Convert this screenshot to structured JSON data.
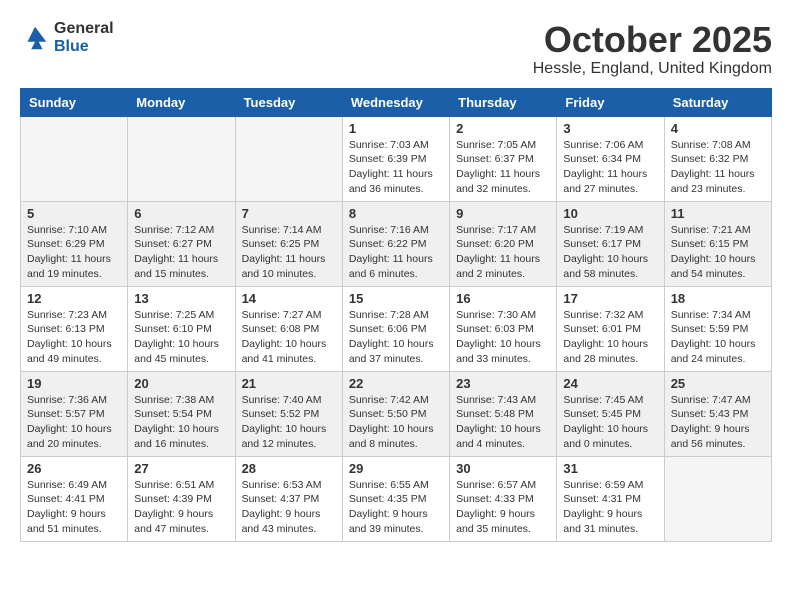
{
  "logo": {
    "general": "General",
    "blue": "Blue"
  },
  "title": {
    "month": "October 2025",
    "location": "Hessle, England, United Kingdom"
  },
  "headers": [
    "Sunday",
    "Monday",
    "Tuesday",
    "Wednesday",
    "Thursday",
    "Friday",
    "Saturday"
  ],
  "weeks": [
    {
      "shaded": false,
      "days": [
        {
          "number": "",
          "info": ""
        },
        {
          "number": "",
          "info": ""
        },
        {
          "number": "",
          "info": ""
        },
        {
          "number": "1",
          "info": "Sunrise: 7:03 AM\nSunset: 6:39 PM\nDaylight: 11 hours\nand 36 minutes."
        },
        {
          "number": "2",
          "info": "Sunrise: 7:05 AM\nSunset: 6:37 PM\nDaylight: 11 hours\nand 32 minutes."
        },
        {
          "number": "3",
          "info": "Sunrise: 7:06 AM\nSunset: 6:34 PM\nDaylight: 11 hours\nand 27 minutes."
        },
        {
          "number": "4",
          "info": "Sunrise: 7:08 AM\nSunset: 6:32 PM\nDaylight: 11 hours\nand 23 minutes."
        }
      ]
    },
    {
      "shaded": true,
      "days": [
        {
          "number": "5",
          "info": "Sunrise: 7:10 AM\nSunset: 6:29 PM\nDaylight: 11 hours\nand 19 minutes."
        },
        {
          "number": "6",
          "info": "Sunrise: 7:12 AM\nSunset: 6:27 PM\nDaylight: 11 hours\nand 15 minutes."
        },
        {
          "number": "7",
          "info": "Sunrise: 7:14 AM\nSunset: 6:25 PM\nDaylight: 11 hours\nand 10 minutes."
        },
        {
          "number": "8",
          "info": "Sunrise: 7:16 AM\nSunset: 6:22 PM\nDaylight: 11 hours\nand 6 minutes."
        },
        {
          "number": "9",
          "info": "Sunrise: 7:17 AM\nSunset: 6:20 PM\nDaylight: 11 hours\nand 2 minutes."
        },
        {
          "number": "10",
          "info": "Sunrise: 7:19 AM\nSunset: 6:17 PM\nDaylight: 10 hours\nand 58 minutes."
        },
        {
          "number": "11",
          "info": "Sunrise: 7:21 AM\nSunset: 6:15 PM\nDaylight: 10 hours\nand 54 minutes."
        }
      ]
    },
    {
      "shaded": false,
      "days": [
        {
          "number": "12",
          "info": "Sunrise: 7:23 AM\nSunset: 6:13 PM\nDaylight: 10 hours\nand 49 minutes."
        },
        {
          "number": "13",
          "info": "Sunrise: 7:25 AM\nSunset: 6:10 PM\nDaylight: 10 hours\nand 45 minutes."
        },
        {
          "number": "14",
          "info": "Sunrise: 7:27 AM\nSunset: 6:08 PM\nDaylight: 10 hours\nand 41 minutes."
        },
        {
          "number": "15",
          "info": "Sunrise: 7:28 AM\nSunset: 6:06 PM\nDaylight: 10 hours\nand 37 minutes."
        },
        {
          "number": "16",
          "info": "Sunrise: 7:30 AM\nSunset: 6:03 PM\nDaylight: 10 hours\nand 33 minutes."
        },
        {
          "number": "17",
          "info": "Sunrise: 7:32 AM\nSunset: 6:01 PM\nDaylight: 10 hours\nand 28 minutes."
        },
        {
          "number": "18",
          "info": "Sunrise: 7:34 AM\nSunset: 5:59 PM\nDaylight: 10 hours\nand 24 minutes."
        }
      ]
    },
    {
      "shaded": true,
      "days": [
        {
          "number": "19",
          "info": "Sunrise: 7:36 AM\nSunset: 5:57 PM\nDaylight: 10 hours\nand 20 minutes."
        },
        {
          "number": "20",
          "info": "Sunrise: 7:38 AM\nSunset: 5:54 PM\nDaylight: 10 hours\nand 16 minutes."
        },
        {
          "number": "21",
          "info": "Sunrise: 7:40 AM\nSunset: 5:52 PM\nDaylight: 10 hours\nand 12 minutes."
        },
        {
          "number": "22",
          "info": "Sunrise: 7:42 AM\nSunset: 5:50 PM\nDaylight: 10 hours\nand 8 minutes."
        },
        {
          "number": "23",
          "info": "Sunrise: 7:43 AM\nSunset: 5:48 PM\nDaylight: 10 hours\nand 4 minutes."
        },
        {
          "number": "24",
          "info": "Sunrise: 7:45 AM\nSunset: 5:45 PM\nDaylight: 10 hours\nand 0 minutes."
        },
        {
          "number": "25",
          "info": "Sunrise: 7:47 AM\nSunset: 5:43 PM\nDaylight: 9 hours\nand 56 minutes."
        }
      ]
    },
    {
      "shaded": false,
      "days": [
        {
          "number": "26",
          "info": "Sunrise: 6:49 AM\nSunset: 4:41 PM\nDaylight: 9 hours\nand 51 minutes."
        },
        {
          "number": "27",
          "info": "Sunrise: 6:51 AM\nSunset: 4:39 PM\nDaylight: 9 hours\nand 47 minutes."
        },
        {
          "number": "28",
          "info": "Sunrise: 6:53 AM\nSunset: 4:37 PM\nDaylight: 9 hours\nand 43 minutes."
        },
        {
          "number": "29",
          "info": "Sunrise: 6:55 AM\nSunset: 4:35 PM\nDaylight: 9 hours\nand 39 minutes."
        },
        {
          "number": "30",
          "info": "Sunrise: 6:57 AM\nSunset: 4:33 PM\nDaylight: 9 hours\nand 35 minutes."
        },
        {
          "number": "31",
          "info": "Sunrise: 6:59 AM\nSunset: 4:31 PM\nDaylight: 9 hours\nand 31 minutes."
        },
        {
          "number": "",
          "info": ""
        }
      ]
    }
  ]
}
